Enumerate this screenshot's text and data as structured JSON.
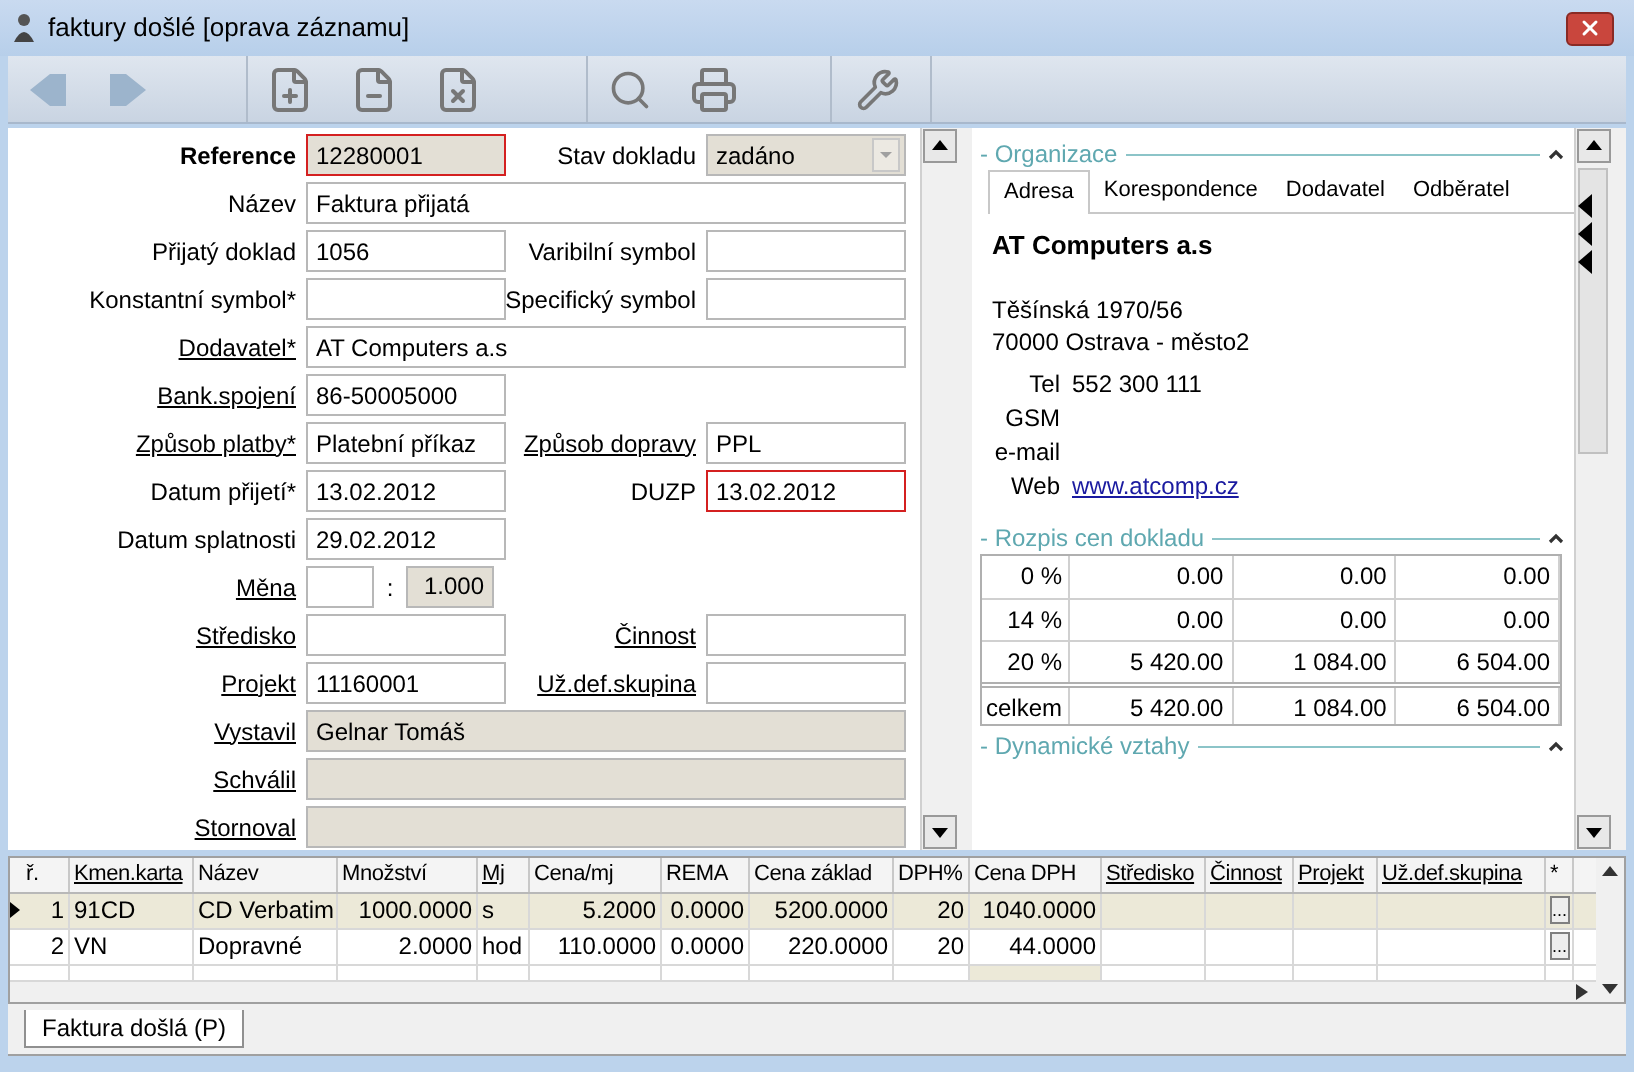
{
  "window": {
    "title": "faktury došlé [oprava záznamu]"
  },
  "form": {
    "rows": [
      {
        "fields": [
          {
            "label": "Reference",
            "bold": true,
            "value": "12280001",
            "error": true,
            "readonly": true
          },
          {
            "label": "Stav dokladu",
            "kind": "select",
            "value": "zadáno",
            "readonly": true
          }
        ]
      },
      {
        "fields": [
          {
            "label": "Název",
            "value": "Faktura přijatá",
            "wide": true
          }
        ]
      },
      {
        "fields": [
          {
            "label": "Přijatý doklad",
            "value": "1056"
          },
          {
            "label": "Varibilní symbol"
          }
        ]
      },
      {
        "fields": [
          {
            "label": "Konstantní symbol*"
          },
          {
            "label": "Specifický symbol"
          }
        ]
      },
      {
        "fields": [
          {
            "label": "Dodavatel*",
            "link": true,
            "value": "AT Computers a.s",
            "wide": true
          }
        ]
      },
      {
        "fields": [
          {
            "label": "Bank.spojení",
            "link": true,
            "value": "86-50005000"
          }
        ]
      },
      {
        "fields": [
          {
            "label": "Způsob platby*",
            "link": true,
            "value": "Platební příkaz"
          },
          {
            "label": "Způsob dopravy",
            "link": true,
            "value": "PPL"
          }
        ]
      },
      {
        "fields": [
          {
            "label": "Datum přijetí*",
            "value": "13.02.2012"
          },
          {
            "label": "DUZP",
            "value": "13.02.2012",
            "error": true
          }
        ]
      },
      {
        "fields": [
          {
            "label": "Datum splatnosti",
            "value": "29.02.2012"
          }
        ]
      },
      {
        "fields": [
          {
            "label": "Měna",
            "link": true,
            "kind": "currency",
            "separator": ":",
            "rate": "1.000"
          }
        ]
      },
      {
        "fields": [
          {
            "label": "Středisko",
            "link": true
          },
          {
            "label": "Činnost",
            "link": true
          }
        ]
      },
      {
        "fields": [
          {
            "label": "Projekt",
            "link": true,
            "value": "11160001"
          },
          {
            "label": "Už.def.skupina",
            "link": true
          }
        ]
      },
      {
        "fields": [
          {
            "label": "Vystavil",
            "link": true,
            "value": "Gelnar Tomáš",
            "wide": true,
            "readonly": true
          }
        ]
      },
      {
        "fields": [
          {
            "label": "Schválil",
            "link": true,
            "wide": true,
            "readonly": true
          }
        ]
      },
      {
        "fields": [
          {
            "label": "Stornoval",
            "link": true,
            "wide": true,
            "readonly": true
          }
        ]
      }
    ]
  },
  "organization": {
    "title": "- Organizace",
    "tabs": [
      {
        "label": "Adresa",
        "selected": true
      },
      {
        "label": "Korespondence",
        "selected": false
      },
      {
        "label": "Dodavatel",
        "selected": false
      },
      {
        "label": "Odběratel",
        "selected": false
      }
    ],
    "name": "AT Computers a.s",
    "address": [
      "Těšínská 1970/56",
      "70000 Ostrava - město2"
    ],
    "contacts": [
      {
        "label": "Tel",
        "value": "552 300 111"
      },
      {
        "label": "GSM"
      },
      {
        "label": "e-mail"
      },
      {
        "label": "Web",
        "value": "www.atcomp.cz",
        "link": true
      }
    ]
  },
  "price_breakdown": {
    "title": "- Rozpis cen dokladu",
    "rows": [
      {
        "label": "0 %",
        "cells": [
          "0.00",
          "0.00",
          "0.00"
        ]
      },
      {
        "label": "14 %",
        "cells": [
          "0.00",
          "0.00",
          "0.00"
        ]
      },
      {
        "label": "20 %",
        "cells": [
          "5 420.00",
          "1 084.00",
          "6 504.00"
        ]
      },
      {
        "label": "celkem",
        "total": true,
        "cells": [
          "5 420.00",
          "1 084.00",
          "6 504.00"
        ]
      }
    ]
  },
  "dynamic_relations": {
    "title": "- Dynamické vztahy"
  },
  "items_table": {
    "columns": [
      {
        "label": "ř."
      },
      {
        "label": "Kmen.karta",
        "link": true
      },
      {
        "label": "Název"
      },
      {
        "label": "Množství"
      },
      {
        "label": "Mj",
        "link": true
      },
      {
        "label": "Cena/mj"
      },
      {
        "label": "REMA"
      },
      {
        "label": "Cena základ"
      },
      {
        "label": "DPH%"
      },
      {
        "label": "Cena DPH"
      },
      {
        "label": "Středisko",
        "link": true
      },
      {
        "label": "Činnost",
        "link": true
      },
      {
        "label": "Projekt",
        "link": true
      },
      {
        "label": "Už.def.skupina",
        "link": true
      },
      {
        "label": "*"
      }
    ],
    "rows": [
      {
        "selected": true,
        "cells": [
          "1",
          "91CD",
          "CD Verbatim",
          "1000.0000",
          "s",
          "5.2000",
          "0.0000",
          "5200.0000",
          "20",
          "1040.0000"
        ],
        "button": "..."
      },
      {
        "selected": false,
        "cells": [
          "2",
          "VN",
          "Dopravné",
          "2.0000",
          "hod",
          "110.0000",
          "0.0000",
          "220.0000",
          "20",
          "44.0000"
        ],
        "button": "..."
      }
    ]
  },
  "bottom_tabs": [
    {
      "label": "Faktura došlá (P)",
      "selected": true
    }
  ]
}
